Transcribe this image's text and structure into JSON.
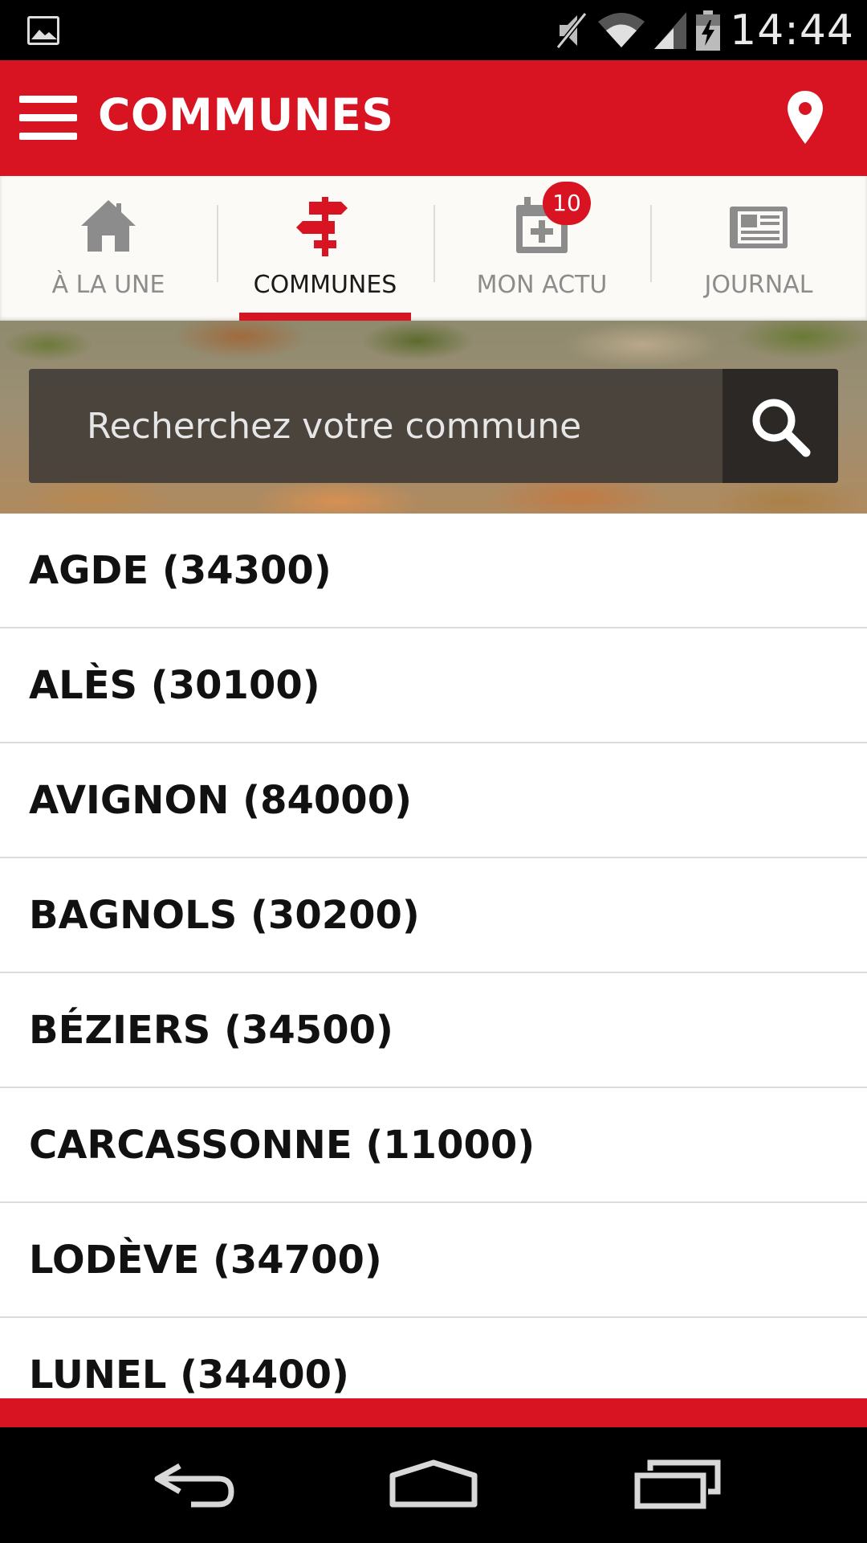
{
  "status_bar": {
    "time": "14:44",
    "icons": [
      "image-notification-icon",
      "mute-icon",
      "wifi-icon",
      "signal-icon",
      "battery-charging-icon"
    ]
  },
  "app_bar": {
    "title": "COMMUNES",
    "icons": [
      "menu-icon",
      "location-pin-icon"
    ]
  },
  "tabs": [
    {
      "label": "À LA UNE",
      "icon": "home-icon",
      "active": false
    },
    {
      "label": "COMMUNES",
      "icon": "signpost-icon",
      "active": true
    },
    {
      "label": "MON ACTU",
      "icon": "calendar-add-icon",
      "active": false,
      "badge": "10"
    },
    {
      "label": "JOURNAL",
      "icon": "newspaper-icon",
      "active": false
    }
  ],
  "search": {
    "placeholder": "Recherchez votre commune"
  },
  "communes": [
    "AGDE (34300)",
    "ALÈS (30100)",
    "AVIGNON (84000)",
    "BAGNOLS (30200)",
    "BÉZIERS (34500)",
    "CARCASSONNE (11000)",
    "LODÈVE (34700)",
    "LUNEL (34400)"
  ],
  "nav_bar": {
    "icons": [
      "back-icon",
      "home-nav-icon",
      "recents-icon"
    ]
  },
  "colors": {
    "brand_red": "#d91422",
    "tab_background": "#fcfaf6"
  }
}
